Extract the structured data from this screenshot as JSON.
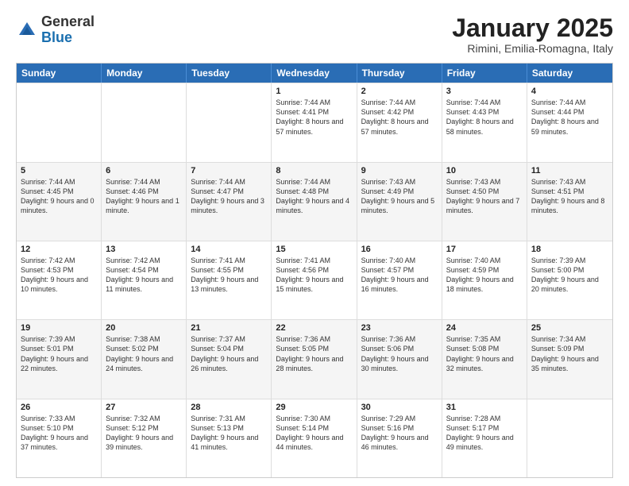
{
  "logo": {
    "general": "General",
    "blue": "Blue"
  },
  "header": {
    "month": "January 2025",
    "location": "Rimini, Emilia-Romagna, Italy"
  },
  "weekdays": [
    "Sunday",
    "Monday",
    "Tuesday",
    "Wednesday",
    "Thursday",
    "Friday",
    "Saturday"
  ],
  "rows": [
    [
      {
        "day": "",
        "text": ""
      },
      {
        "day": "",
        "text": ""
      },
      {
        "day": "",
        "text": ""
      },
      {
        "day": "1",
        "text": "Sunrise: 7:44 AM\nSunset: 4:41 PM\nDaylight: 8 hours\nand 57 minutes."
      },
      {
        "day": "2",
        "text": "Sunrise: 7:44 AM\nSunset: 4:42 PM\nDaylight: 8 hours\nand 57 minutes."
      },
      {
        "day": "3",
        "text": "Sunrise: 7:44 AM\nSunset: 4:43 PM\nDaylight: 8 hours\nand 58 minutes."
      },
      {
        "day": "4",
        "text": "Sunrise: 7:44 AM\nSunset: 4:44 PM\nDaylight: 8 hours\nand 59 minutes."
      }
    ],
    [
      {
        "day": "5",
        "text": "Sunrise: 7:44 AM\nSunset: 4:45 PM\nDaylight: 9 hours\nand 0 minutes."
      },
      {
        "day": "6",
        "text": "Sunrise: 7:44 AM\nSunset: 4:46 PM\nDaylight: 9 hours\nand 1 minute."
      },
      {
        "day": "7",
        "text": "Sunrise: 7:44 AM\nSunset: 4:47 PM\nDaylight: 9 hours\nand 3 minutes."
      },
      {
        "day": "8",
        "text": "Sunrise: 7:44 AM\nSunset: 4:48 PM\nDaylight: 9 hours\nand 4 minutes."
      },
      {
        "day": "9",
        "text": "Sunrise: 7:43 AM\nSunset: 4:49 PM\nDaylight: 9 hours\nand 5 minutes."
      },
      {
        "day": "10",
        "text": "Sunrise: 7:43 AM\nSunset: 4:50 PM\nDaylight: 9 hours\nand 7 minutes."
      },
      {
        "day": "11",
        "text": "Sunrise: 7:43 AM\nSunset: 4:51 PM\nDaylight: 9 hours\nand 8 minutes."
      }
    ],
    [
      {
        "day": "12",
        "text": "Sunrise: 7:42 AM\nSunset: 4:53 PM\nDaylight: 9 hours\nand 10 minutes."
      },
      {
        "day": "13",
        "text": "Sunrise: 7:42 AM\nSunset: 4:54 PM\nDaylight: 9 hours\nand 11 minutes."
      },
      {
        "day": "14",
        "text": "Sunrise: 7:41 AM\nSunset: 4:55 PM\nDaylight: 9 hours\nand 13 minutes."
      },
      {
        "day": "15",
        "text": "Sunrise: 7:41 AM\nSunset: 4:56 PM\nDaylight: 9 hours\nand 15 minutes."
      },
      {
        "day": "16",
        "text": "Sunrise: 7:40 AM\nSunset: 4:57 PM\nDaylight: 9 hours\nand 16 minutes."
      },
      {
        "day": "17",
        "text": "Sunrise: 7:40 AM\nSunset: 4:59 PM\nDaylight: 9 hours\nand 18 minutes."
      },
      {
        "day": "18",
        "text": "Sunrise: 7:39 AM\nSunset: 5:00 PM\nDaylight: 9 hours\nand 20 minutes."
      }
    ],
    [
      {
        "day": "19",
        "text": "Sunrise: 7:39 AM\nSunset: 5:01 PM\nDaylight: 9 hours\nand 22 minutes."
      },
      {
        "day": "20",
        "text": "Sunrise: 7:38 AM\nSunset: 5:02 PM\nDaylight: 9 hours\nand 24 minutes."
      },
      {
        "day": "21",
        "text": "Sunrise: 7:37 AM\nSunset: 5:04 PM\nDaylight: 9 hours\nand 26 minutes."
      },
      {
        "day": "22",
        "text": "Sunrise: 7:36 AM\nSunset: 5:05 PM\nDaylight: 9 hours\nand 28 minutes."
      },
      {
        "day": "23",
        "text": "Sunrise: 7:36 AM\nSunset: 5:06 PM\nDaylight: 9 hours\nand 30 minutes."
      },
      {
        "day": "24",
        "text": "Sunrise: 7:35 AM\nSunset: 5:08 PM\nDaylight: 9 hours\nand 32 minutes."
      },
      {
        "day": "25",
        "text": "Sunrise: 7:34 AM\nSunset: 5:09 PM\nDaylight: 9 hours\nand 35 minutes."
      }
    ],
    [
      {
        "day": "26",
        "text": "Sunrise: 7:33 AM\nSunset: 5:10 PM\nDaylight: 9 hours\nand 37 minutes."
      },
      {
        "day": "27",
        "text": "Sunrise: 7:32 AM\nSunset: 5:12 PM\nDaylight: 9 hours\nand 39 minutes."
      },
      {
        "day": "28",
        "text": "Sunrise: 7:31 AM\nSunset: 5:13 PM\nDaylight: 9 hours\nand 41 minutes."
      },
      {
        "day": "29",
        "text": "Sunrise: 7:30 AM\nSunset: 5:14 PM\nDaylight: 9 hours\nand 44 minutes."
      },
      {
        "day": "30",
        "text": "Sunrise: 7:29 AM\nSunset: 5:16 PM\nDaylight: 9 hours\nand 46 minutes."
      },
      {
        "day": "31",
        "text": "Sunrise: 7:28 AM\nSunset: 5:17 PM\nDaylight: 9 hours\nand 49 minutes."
      },
      {
        "day": "",
        "text": ""
      }
    ]
  ]
}
